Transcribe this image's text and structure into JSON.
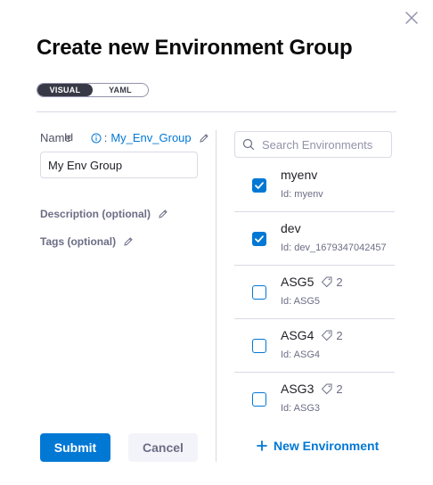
{
  "dialog": {
    "title": "Create new Environment Group",
    "close_icon": "close-icon"
  },
  "mode_toggle": {
    "options": [
      "VISUAL",
      "YAML"
    ],
    "selected": "VISUAL"
  },
  "form": {
    "name_label": "Name",
    "id_label": "Id",
    "id_value": "My_Env_Group",
    "name_value": "My Env Group",
    "description_label": "Description (optional)",
    "tags_label": "Tags (optional)"
  },
  "env_panel": {
    "search_placeholder": "Search Environments",
    "items": [
      {
        "name": "myenv",
        "id_text": "Id: myenv",
        "checked": true,
        "tag_count": ""
      },
      {
        "name": "dev",
        "id_text": "Id: dev_1679347042457",
        "checked": true,
        "tag_count": ""
      },
      {
        "name": "ASG5",
        "id_text": "Id: ASG5",
        "checked": false,
        "tag_count": "2"
      },
      {
        "name": "ASG4",
        "id_text": "Id: ASG4",
        "checked": false,
        "tag_count": "2"
      },
      {
        "name": "ASG3",
        "id_text": "Id: ASG3",
        "checked": false,
        "tag_count": "2"
      }
    ],
    "new_env_label": "New Environment"
  },
  "footer": {
    "submit_label": "Submit",
    "cancel_label": "Cancel"
  },
  "colors": {
    "primary": "#0278d5",
    "toggle_active": "#383946",
    "divider": "#d9dae5"
  }
}
